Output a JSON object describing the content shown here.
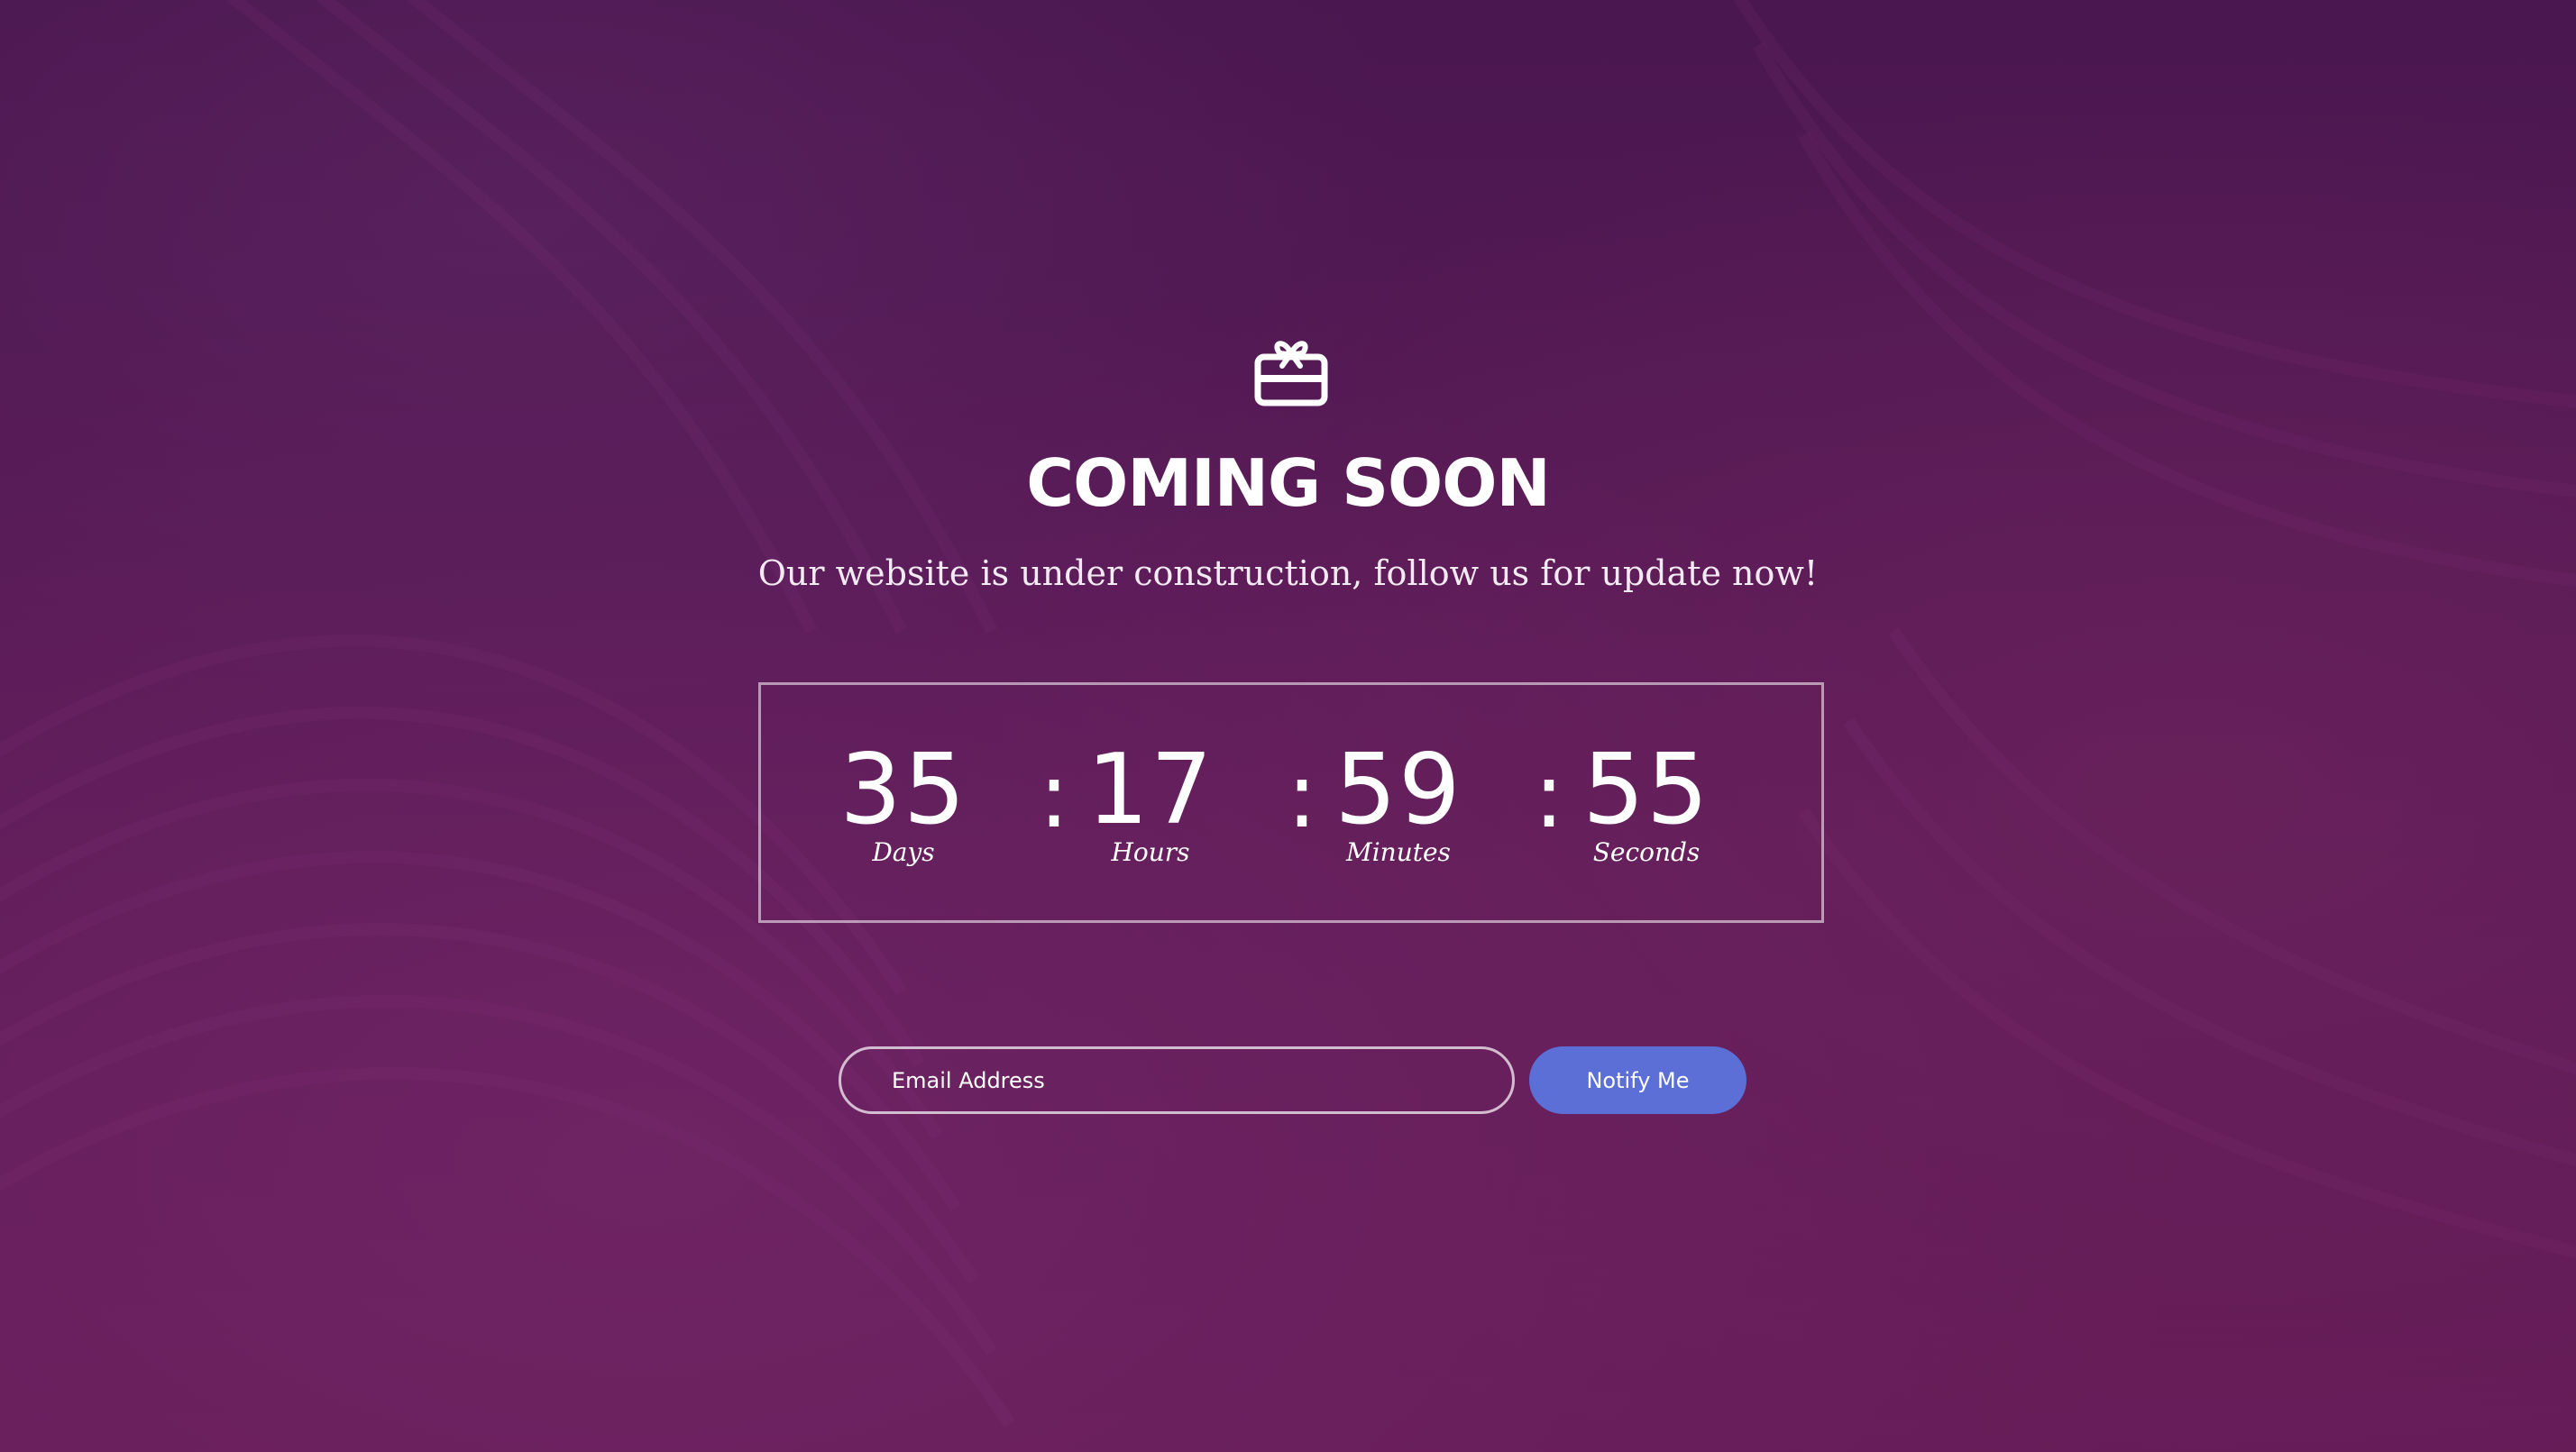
{
  "header": {
    "logo_icon": "gift-box-icon",
    "title": "COMING SOON",
    "subtitle": "Our website is under construction, follow us for update now!"
  },
  "countdown": {
    "separator": ":",
    "units": [
      {
        "value": "35",
        "label": "Days"
      },
      {
        "value": "17",
        "label": "Hours"
      },
      {
        "value": "59",
        "label": "Minutes"
      },
      {
        "value": "55",
        "label": "Seconds"
      }
    ]
  },
  "subscribe": {
    "email_placeholder": "Email Address",
    "button_label": "Notify Me"
  },
  "colors": {
    "background_top": "#4a1750",
    "background_bottom": "#651c57",
    "button": "#5b6fd6",
    "text": "#ffffff"
  }
}
